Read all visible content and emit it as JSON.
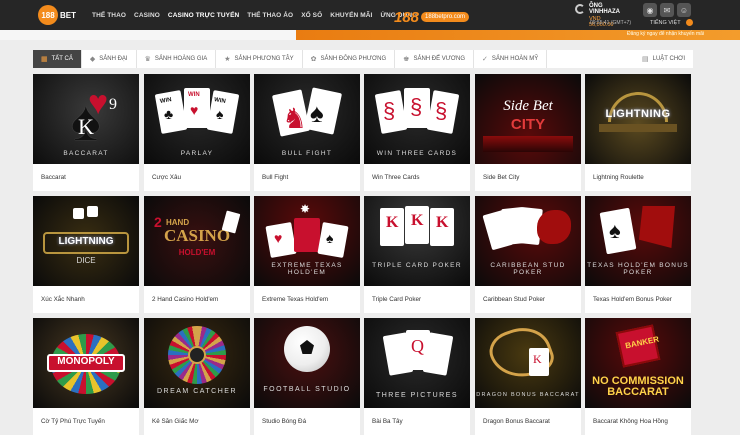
{
  "header": {
    "logo_number": "188",
    "logo_text": "BET",
    "nav": [
      "THỂ THAO",
      "CASINO",
      "CASINO TRỰC TUYẾN",
      "THỂ THAO ẢO",
      "XỔ SỐ",
      "KHUYẾN MÃI",
      "ỨNG DỤNG"
    ],
    "active_nav": "CASINO TRỰC TUYẾN",
    "banner_big": "188",
    "banner_small": "188betpro.com",
    "user_name": "ÔNG VINHHAZA",
    "balance": "VND 56,000.00",
    "time": "09:55:41 (GMT+7)",
    "language": "TIẾNG VIỆT",
    "subbar_text": "Đăng ký ngay để nhận khuyến mãi"
  },
  "filters": {
    "items": [
      {
        "label": "TẤT CẢ",
        "icon": "grid-icon",
        "active": true
      },
      {
        "label": "SẢNH ĐẠI",
        "icon": "diamond-icon",
        "active": false
      },
      {
        "label": "SẢNH HOÀNG GIA",
        "icon": "crown-icon",
        "active": false
      },
      {
        "label": "SẢNH PHƯƠNG TÂY",
        "icon": "star-icon",
        "active": false
      },
      {
        "label": "SẢNH ĐÔNG PHƯƠNG",
        "icon": "lotus-icon",
        "active": false
      },
      {
        "label": "SẢNH ĐẾ VƯƠNG",
        "icon": "crown-icon",
        "active": false
      },
      {
        "label": "SẢNH HOÀN MỸ",
        "icon": "check-icon",
        "active": false
      }
    ],
    "rules_label": "LUẬT CHƠI"
  },
  "games": [
    {
      "title": "Baccarat",
      "art": "BACCARAT"
    },
    {
      "title": "Cược Xâu",
      "art": "PARLAY"
    },
    {
      "title": "Bull Fight",
      "art": "BULL FIGHT"
    },
    {
      "title": "Win Three Cards",
      "art": "WIN THREE CARDS"
    },
    {
      "title": "Side Bet City",
      "art": "Side Bet CITY"
    },
    {
      "title": "Lightning Roulette",
      "art": "LIGHTNING"
    },
    {
      "title": "Xúc Xắc Nhanh",
      "art": "LIGHTNING DICE"
    },
    {
      "title": "2 Hand Casino Hold'em",
      "art": "2 HAND CASINO HOLD'EM"
    },
    {
      "title": "Extreme Texas Hold'em",
      "art": "EXTREME TEXAS HOLD'EM"
    },
    {
      "title": "Triple Card Poker",
      "art": "TRIPLE CARD POKER"
    },
    {
      "title": "Caribbean Stud Poker",
      "art": "CARIBBEAN STUD POKER"
    },
    {
      "title": "Texas Hold'em Bonus Poker",
      "art": "TEXAS HOLD'EM BONUS POKER"
    },
    {
      "title": "Cờ Tỷ Phú Trực Tuyến",
      "art": "MONOPOLY"
    },
    {
      "title": "Kẻ Săn Giấc Mơ",
      "art": "DREAM CATCHER"
    },
    {
      "title": "Studio Bóng Đá",
      "art": "FOOTBALL STUDIO"
    },
    {
      "title": "Bài Ba Tây",
      "art": "THREE PICTURES"
    },
    {
      "title": "Dragon Bonus Baccarat",
      "art": "DRAGON BONUS BACCARAT"
    },
    {
      "title": "Baccarat Không Hoa Hồng",
      "art": "NO COMMISSION BACCARAT"
    }
  ],
  "colors": {
    "accent": "#f38b1c",
    "dark": "#262626",
    "card_bg": "#111111"
  }
}
